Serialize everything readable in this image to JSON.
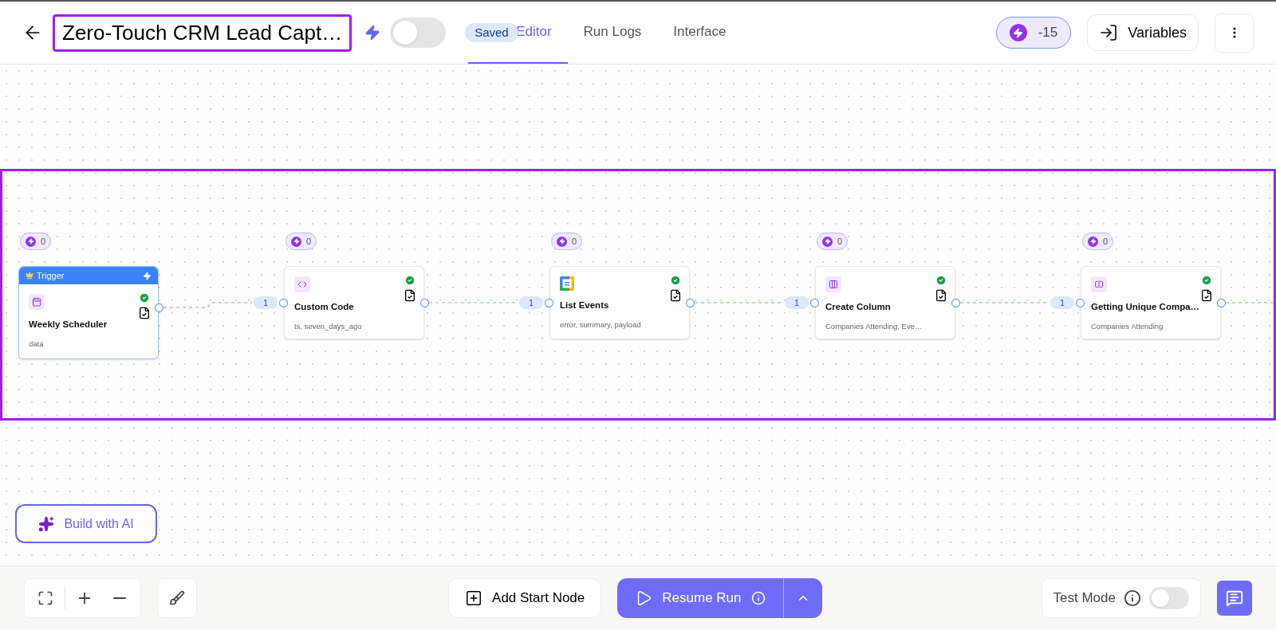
{
  "header": {
    "title": "Zero-Touch CRM Lead Capt…",
    "active": false,
    "saved": "Saved",
    "tabs": [
      {
        "label": "Editor",
        "selected": true
      },
      {
        "label": "Run Logs",
        "selected": false
      },
      {
        "label": "Interface",
        "selected": false
      }
    ],
    "credits": "-15",
    "variables": "Variables"
  },
  "nodes": [
    {
      "kind": "trigger",
      "header": "Trigger",
      "title": "Weekly Scheduler",
      "outputs": "data",
      "credits": "0",
      "success": true
    },
    {
      "kind": "action",
      "title": "Custom Code",
      "outputs": "ts, seven_days_ago",
      "credits": "0",
      "success": true
    },
    {
      "kind": "action",
      "title": "List Events",
      "outputs": "error, summary, payload",
      "credits": "0",
      "success": true
    },
    {
      "kind": "action",
      "title": "Create Column",
      "outputs": "Companies Attending, Eve…",
      "credits": "0",
      "success": true
    },
    {
      "kind": "action",
      "title": "Getting Unique Compa…",
      "outputs": "Companies Attending",
      "credits": "0",
      "success": true
    }
  ],
  "edges": [
    {
      "label": "1",
      "color": "#f0b8e0"
    },
    {
      "label": "1",
      "color": "#bfe0f0"
    },
    {
      "label": "1",
      "color": "#b8e0a8"
    },
    {
      "label": "1",
      "color": "#b8e0a8"
    },
    {
      "color": "#b8e0a8"
    }
  ],
  "build_ai": "Build with AI",
  "toolbar": {
    "add_start": "Add Start Node",
    "resume": "Resume Run",
    "test_mode": "Test Mode",
    "test_on": false
  }
}
